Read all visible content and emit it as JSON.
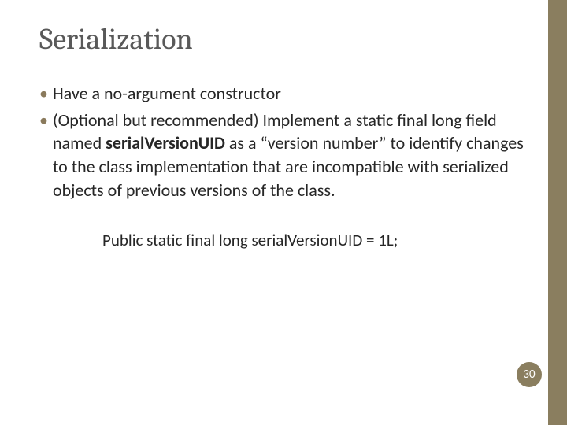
{
  "title": "Serialization",
  "bullets": [
    {
      "parts": [
        {
          "text": "Have a no-argument constructor",
          "bold": false
        }
      ]
    },
    {
      "parts": [
        {
          "text": "(Optional but recommended) Implement a static final long field named ",
          "bold": false
        },
        {
          "text": "serialVersionUID",
          "bold": true
        },
        {
          "text": " as a “version number” to identify changes to the class implementation that are incompatible with serialized objects of previous versions of the class.",
          "bold": false
        }
      ]
    }
  ],
  "code_line": "Public static final long serialVersionUID = 1L;",
  "page_number": "30"
}
